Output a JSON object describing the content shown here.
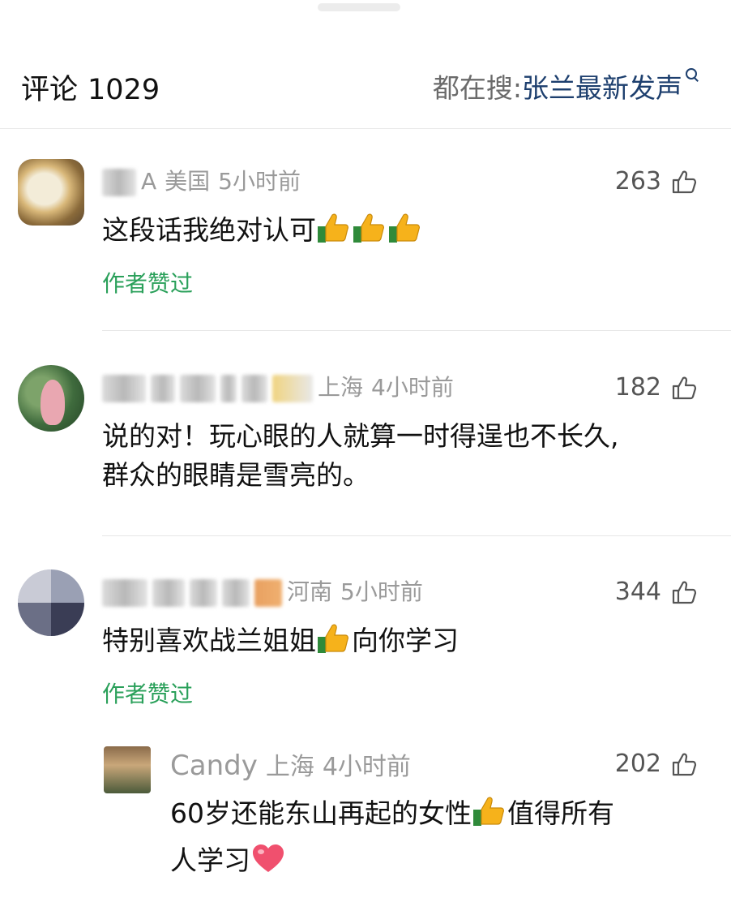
{
  "header": {
    "title": "评论",
    "count": "1029",
    "search_label": "都在搜: ",
    "search_term": "张兰最新发声"
  },
  "comments": [
    {
      "user": "A",
      "region": "美国",
      "time": "5小时前",
      "likes": "263",
      "text": "这段话我绝对认可",
      "emoji_count": 3,
      "author_liked": "作者赞过"
    },
    {
      "user": "",
      "region": "上海",
      "time": "4小时前",
      "likes": "182",
      "text_line1": "说的对！玩心眼的人就算一时得逞也不长久,",
      "text_line2": "群众的眼睛是雪亮的。"
    },
    {
      "user": "",
      "region": "河南",
      "time": "5小时前",
      "likes": "344",
      "text_before": "特别喜欢战兰姐姐",
      "text_after": "向你学习",
      "author_liked": "作者赞过"
    }
  ],
  "reply": {
    "user": "Candy",
    "region": "上海",
    "time": "4小时前",
    "likes": "202",
    "text_line1_before": "60岁还能东山再起的女性",
    "text_line1_after": "值得所有",
    "text_line2": "人学习"
  },
  "colors": {
    "author_liked": "#2aa05a",
    "search_term": "#1d3f6e",
    "meta": "#9a9a9a"
  }
}
